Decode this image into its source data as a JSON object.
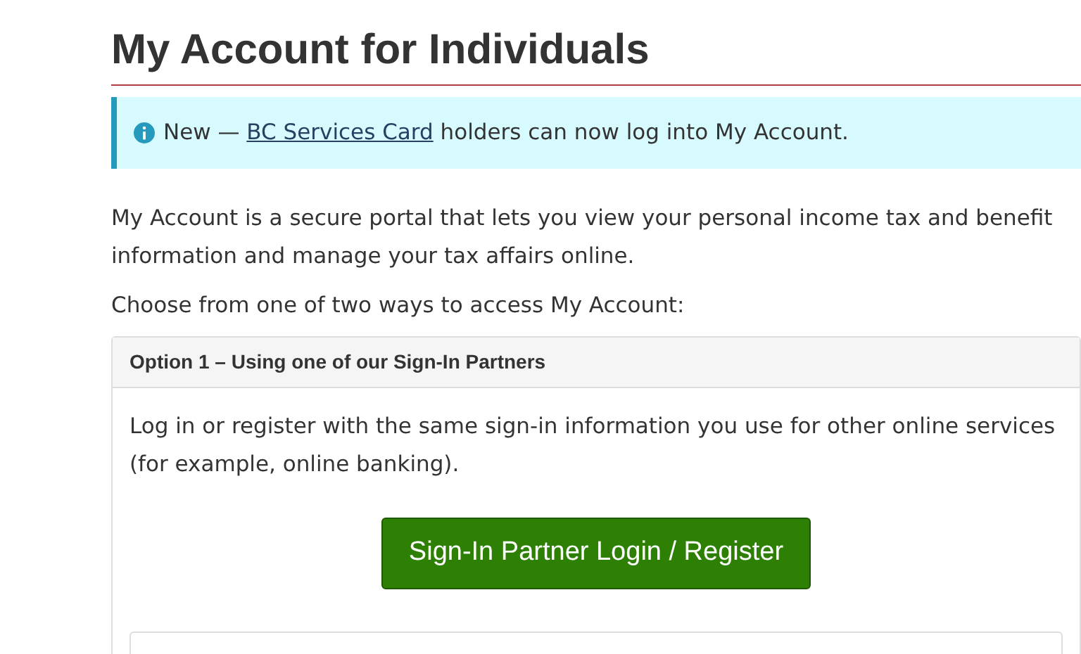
{
  "title": "My Account for Individuals",
  "alert": {
    "prefix": "New — ",
    "link": "BC Services Card",
    "suffix": " holders can now log into My Account."
  },
  "paragraphs": [
    "My Account is a secure portal that lets you view your personal income tax and benefit information and manage your tax affairs online.",
    "Choose from one of two ways to access My Account:"
  ],
  "option": {
    "header": "Option 1 – Using one of our Sign-In Partners",
    "text": "Log in or register with the same sign-in information you use for other online services (for example, online banking).",
    "button": "Sign-In Partner Login / Register"
  }
}
